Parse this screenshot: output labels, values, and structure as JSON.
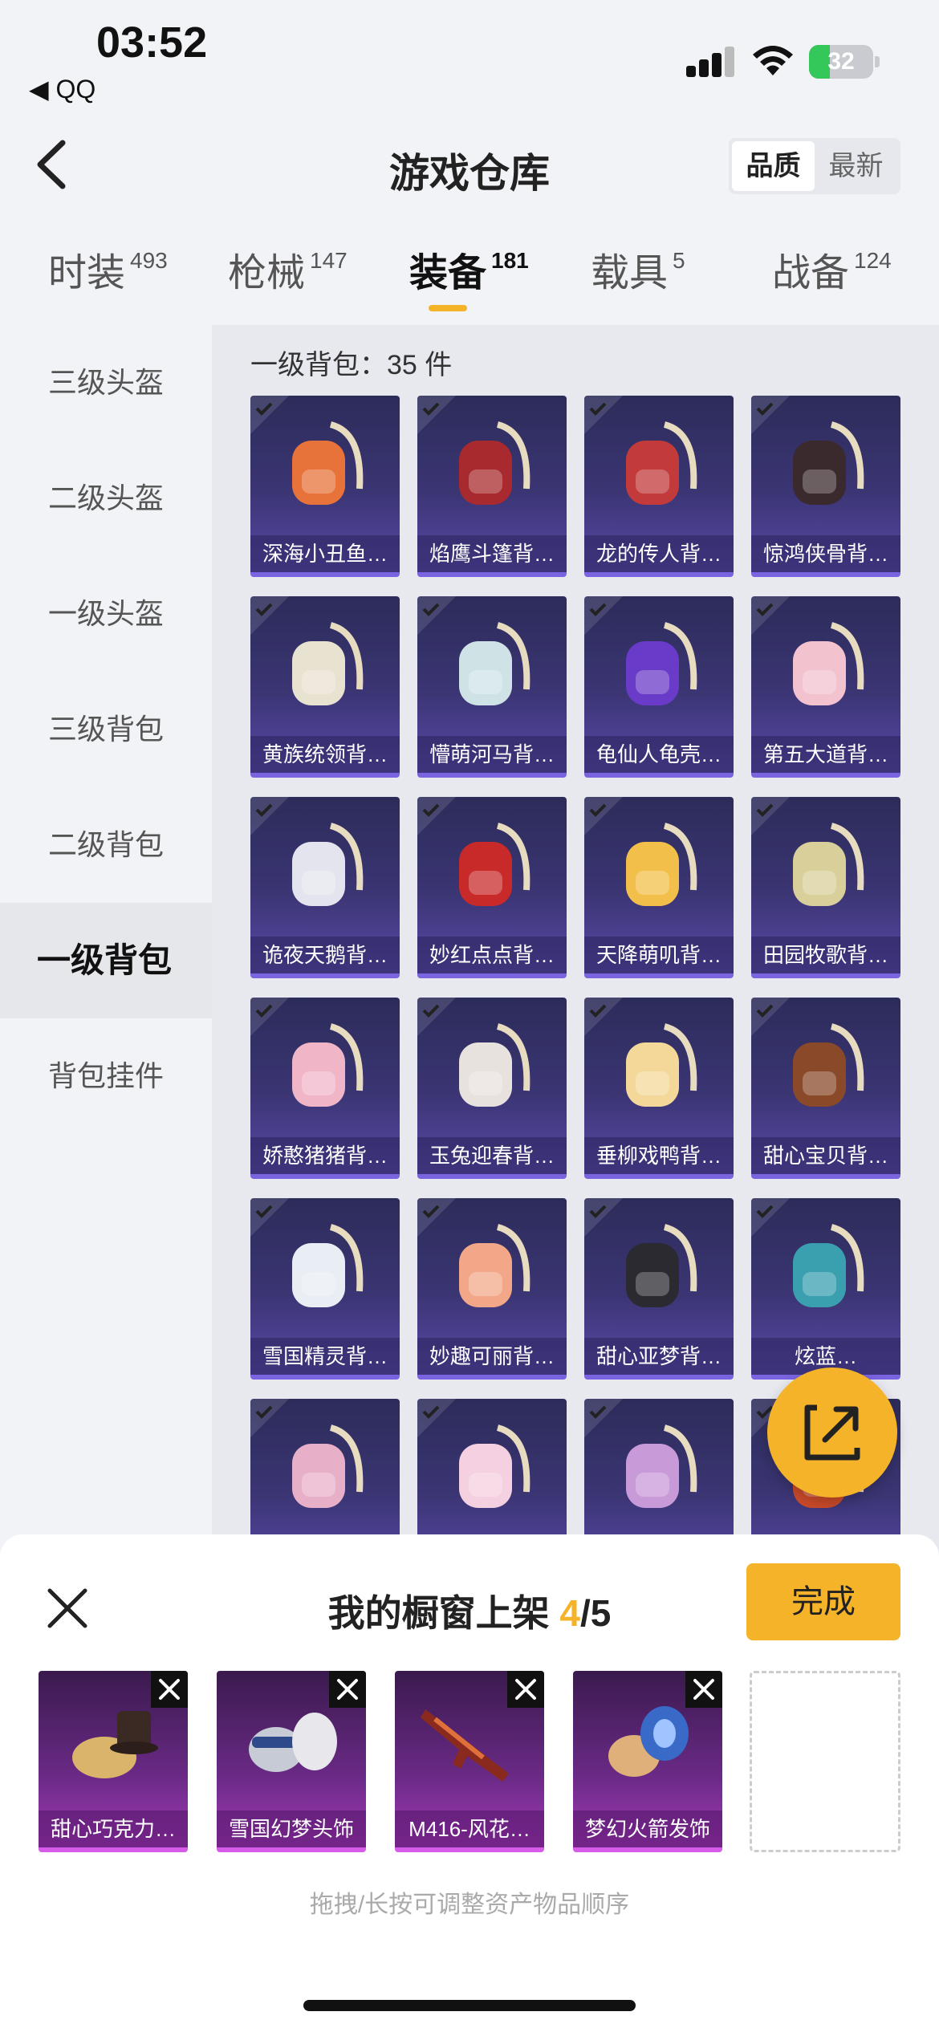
{
  "status_bar": {
    "time": "03:52",
    "back_app": "◀ QQ",
    "battery": "32",
    "battery_level": 0.32
  },
  "header": {
    "title": "游戏仓库",
    "sort_options": [
      "品质",
      "最新"
    ],
    "sort_active": "品质"
  },
  "tabs": [
    {
      "label": "时装",
      "count": "493"
    },
    {
      "label": "枪械",
      "count": "147"
    },
    {
      "label": "装备",
      "count": "181",
      "active": true
    },
    {
      "label": "载具",
      "count": "5"
    },
    {
      "label": "战备",
      "count": "124"
    }
  ],
  "sidebar": {
    "items": [
      "三级头盔",
      "二级头盔",
      "一级头盔",
      "三级背包",
      "二级背包",
      "一级背包",
      "背包挂件"
    ],
    "active": "一级背包"
  },
  "content": {
    "count_label": "一级背包：35 件",
    "items": [
      "深海小丑鱼…",
      "焰鹰斗篷背…",
      "龙的传人背…",
      "惊鸿侠骨背…",
      "黄族统领背…",
      "懵萌河马背…",
      "龟仙人龟壳…",
      "第五大道背…",
      "诡夜天鹅背…",
      "妙红点点背…",
      "天降萌叽背…",
      "田园牧歌背…",
      "娇憨猪猪背…",
      "玉兔迎春背…",
      "垂柳戏鸭背…",
      "甜心宝贝背…",
      "雪国精灵背…",
      "妙趣可丽背…",
      "甜心亚梦背…",
      "炫蓝…",
      "",
      "",
      "",
      ""
    ]
  },
  "panel": {
    "title": "我的橱窗上架",
    "count_current": "4",
    "count_total": "/5",
    "done_label": "完成",
    "shelf_items": [
      "甜心巧克力…",
      "雪国幻梦头饰",
      "M416-风花…",
      "梦幻火箭发饰"
    ],
    "hint": "拖拽/长按可调整资产物品顺序"
  },
  "colors": {
    "accent": "#f5b32a",
    "purple_card": "#3b3574",
    "shelf_card": "#6a2a86"
  }
}
